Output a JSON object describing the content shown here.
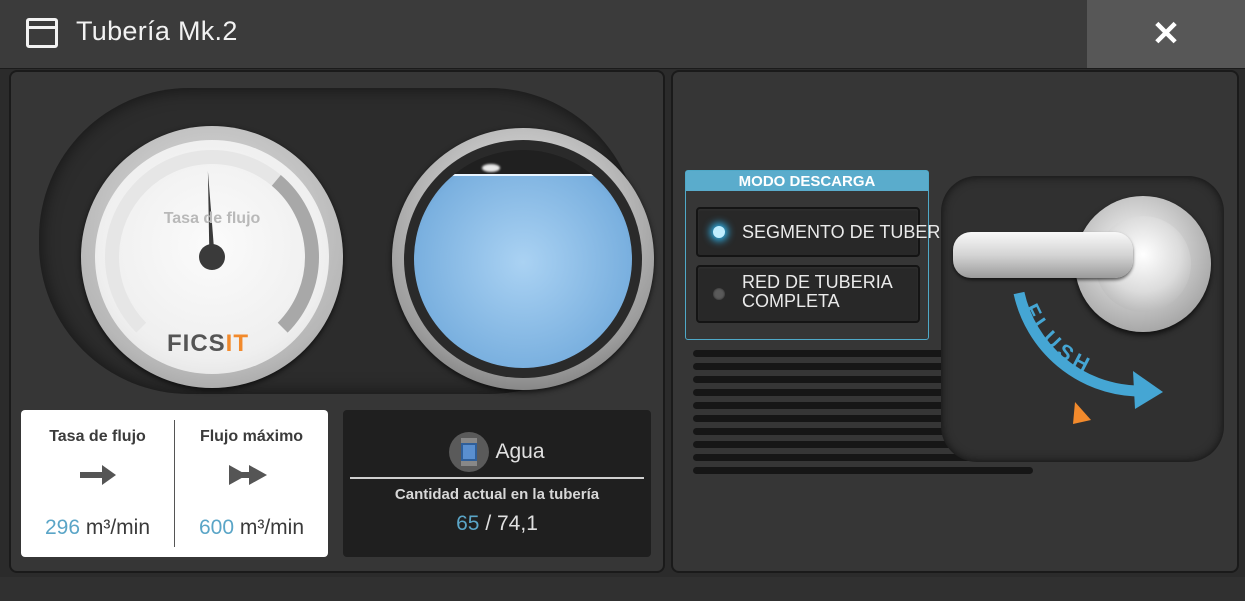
{
  "window": {
    "title": "Tubería Mk.2",
    "close_label": "✕"
  },
  "gauge": {
    "label": "Tasa de flujo",
    "brand_prefix": "FICS",
    "brand_accent": "IT",
    "needle_fraction": 0.49,
    "arc_fill_fraction": 0.5
  },
  "fluid_gauge": {
    "fill_fraction": 0.88,
    "color": "#7ab0df"
  },
  "stats": {
    "flow_rate": {
      "title": "Tasa de flujo",
      "value": "296",
      "unit": "m³/min"
    },
    "max_flow": {
      "title": "Flujo máximo",
      "value": "600",
      "unit": "m³/min"
    }
  },
  "fluid": {
    "name": "Agua",
    "caption": "Cantidad actual en la tubería",
    "current": "65",
    "separator": "/",
    "capacity": "74,1"
  },
  "flush_mode": {
    "header": "MODO DESCARGA",
    "options": [
      {
        "label": "SEGMENTO DE TUBERÍA",
        "selected": true
      },
      {
        "label_line1": "RED DE TUBERIA",
        "label_line2": "COMPLETA",
        "selected": false
      }
    ]
  },
  "flush_lever": {
    "label": "FLUSH"
  },
  "colors": {
    "accent_blue": "#5aaccc",
    "accent_orange": "#f28a2c",
    "value_blue": "#5aa5c7"
  }
}
